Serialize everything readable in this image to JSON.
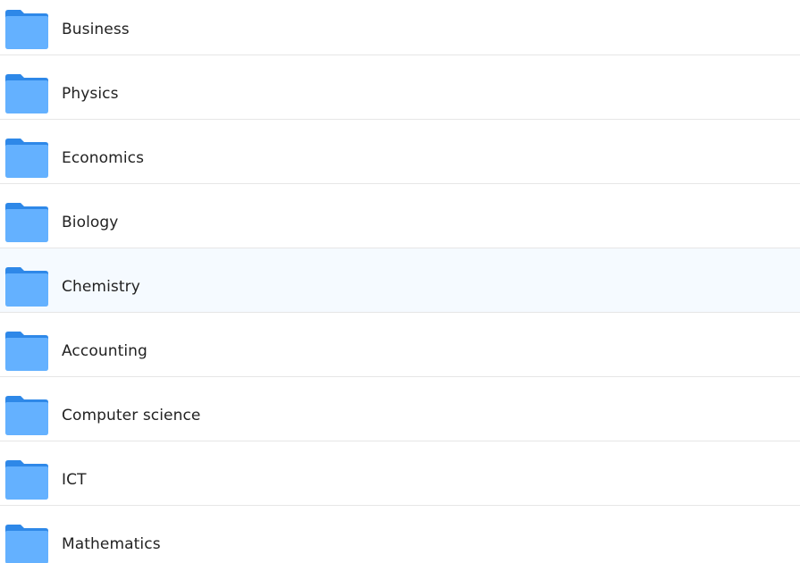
{
  "folders": [
    {
      "label": "Business",
      "highlighted": false
    },
    {
      "label": "Physics",
      "highlighted": false
    },
    {
      "label": "Economics",
      "highlighted": false
    },
    {
      "label": "Biology",
      "highlighted": false
    },
    {
      "label": "Chemistry",
      "highlighted": true
    },
    {
      "label": "Accounting",
      "highlighted": false
    },
    {
      "label": "Computer science",
      "highlighted": false
    },
    {
      "label": "ICT",
      "highlighted": false
    },
    {
      "label": "Mathematics",
      "highlighted": false
    }
  ],
  "colors": {
    "folder_body": "#64b1ff",
    "folder_tab": "#2e88e8",
    "highlight_bg": "#f5faff",
    "divider": "#e6e6e6",
    "text": "#222222"
  },
  "icon": "folder-icon"
}
